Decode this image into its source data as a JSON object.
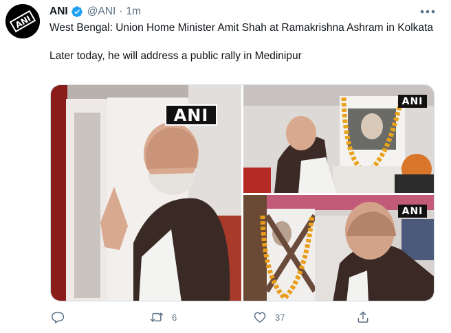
{
  "tweet": {
    "author_name": "ANI",
    "author_handle": "@ANI",
    "separator": "·",
    "time": "1m",
    "avatar_text": "ANI",
    "text_line1": "West Bengal: Union Home Minister Amit Shah at Ramakrishna Ashram in Kolkata",
    "text_line2": "Later today, he will address a public rally in Medinipur",
    "media": {
      "watermarks": [
        "ANI",
        "ANI",
        "ANI"
      ]
    },
    "actions": {
      "reply_count": "",
      "retweet_count": "6",
      "like_count": "37",
      "share_count": ""
    }
  },
  "icons": {
    "avatar": "ani-logo-icon",
    "verified": "verified-badge-icon",
    "more": "more-options-icon",
    "reply": "reply-icon",
    "retweet": "retweet-icon",
    "like": "heart-icon",
    "share": "share-icon"
  },
  "colors": {
    "text": "#0f1419",
    "secondary": "#5b7083",
    "verified": "#1da1f2",
    "border": "#cfd9de"
  }
}
